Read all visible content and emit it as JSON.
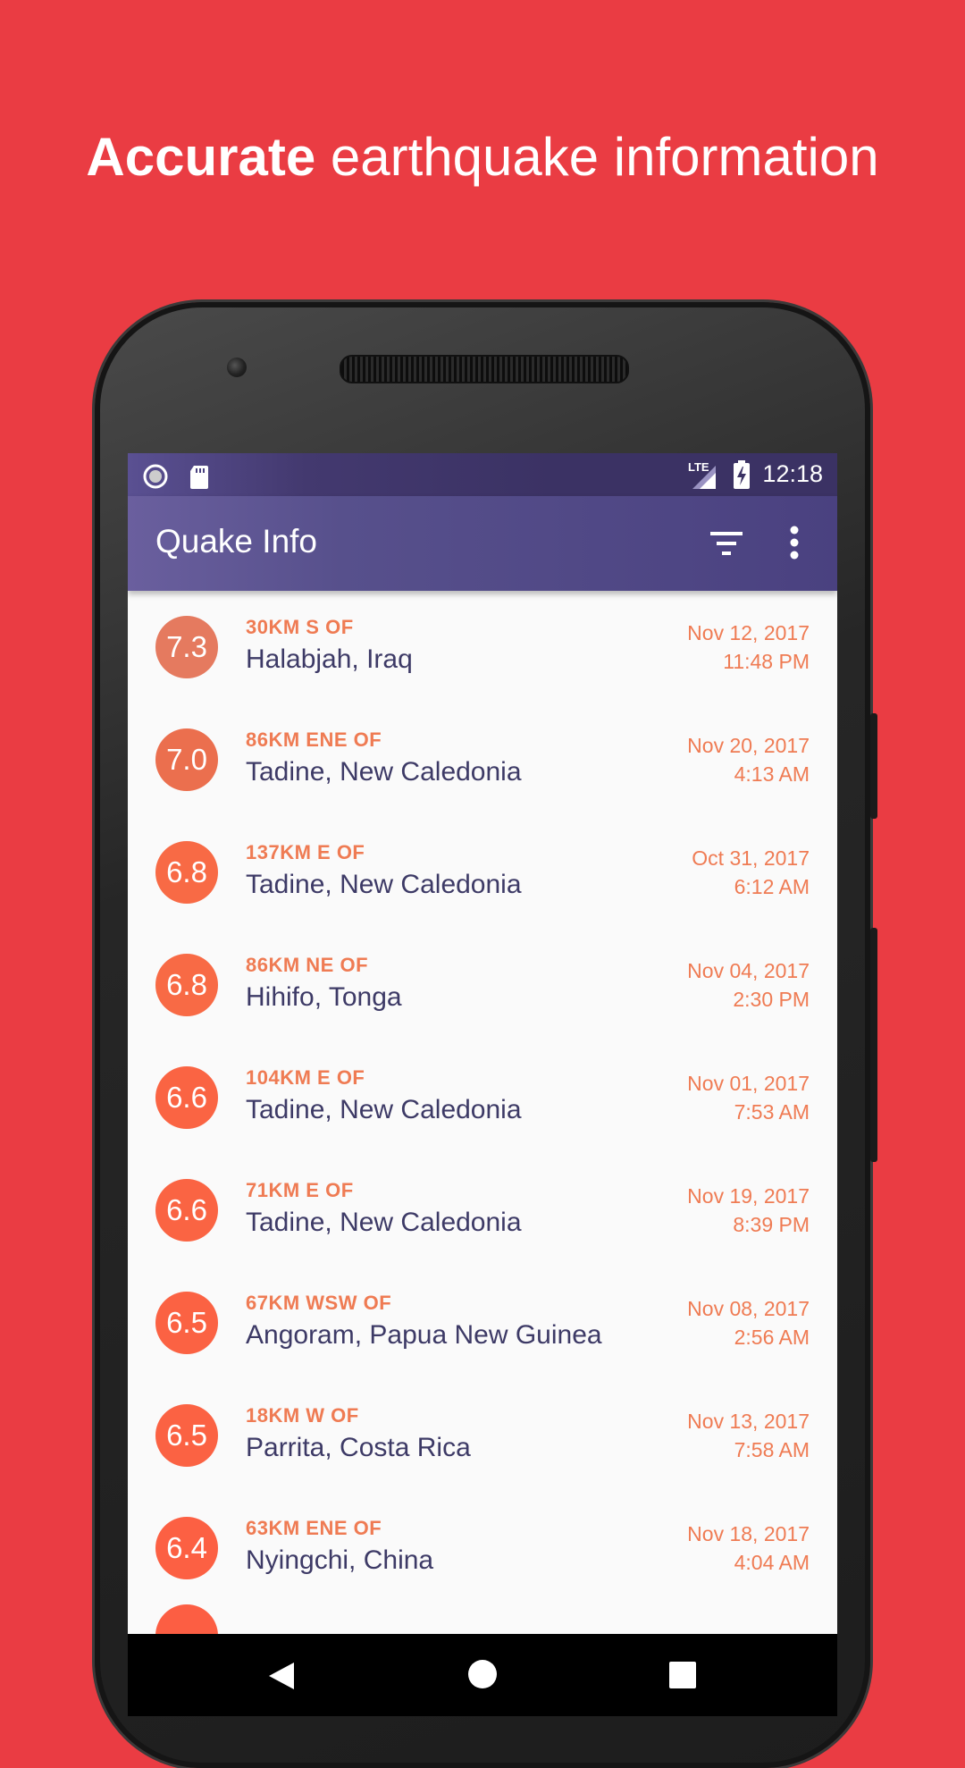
{
  "headline": {
    "bold": "Accurate",
    "rest": "earthquake information"
  },
  "status_bar": {
    "time": "12:18",
    "network": "LTE"
  },
  "app_bar": {
    "title": "Quake Info",
    "filter_icon": "filter-icon",
    "more_icon": "more-vert-icon"
  },
  "quakes": [
    {
      "mag": "7.3",
      "offset": "30KM S OF",
      "place": "Halabjah, Iraq",
      "date": "Nov 12, 2017",
      "time": "11:48 PM",
      "color": "#E57A5F"
    },
    {
      "mag": "7.0",
      "offset": "86KM ENE OF",
      "place": "Tadine, New Caledonia",
      "date": "Nov 20, 2017",
      "time": "4:13 AM",
      "color": "#EB6F4E"
    },
    {
      "mag": "6.8",
      "offset": "137KM E OF",
      "place": "Tadine, New Caledonia",
      "date": "Oct 31, 2017",
      "time": "6:12 AM",
      "color": "#F86A45"
    },
    {
      "mag": "6.8",
      "offset": "86KM NE OF",
      "place": "Hihifo, Tonga",
      "date": "Nov 04, 2017",
      "time": "2:30 PM",
      "color": "#F86A45"
    },
    {
      "mag": "6.6",
      "offset": "104KM E OF",
      "place": "Tadine, New Caledonia",
      "date": "Nov 01, 2017",
      "time": "7:53 AM",
      "color": "#FA6443"
    },
    {
      "mag": "6.6",
      "offset": "71KM E OF",
      "place": "Tadine, New Caledonia",
      "date": "Nov 19, 2017",
      "time": "8:39 PM",
      "color": "#FA6443"
    },
    {
      "mag": "6.5",
      "offset": "67KM WSW OF",
      "place": "Angoram, Papua New Guinea",
      "date": "Nov 08, 2017",
      "time": "2:56 AM",
      "color": "#FB6243"
    },
    {
      "mag": "6.5",
      "offset": "18KM W OF",
      "place": "Parrita, Costa Rica",
      "date": "Nov 13, 2017",
      "time": "7:58 AM",
      "color": "#FB6243"
    },
    {
      "mag": "6.4",
      "offset": "63KM ENE OF",
      "place": "Nyingchi, China",
      "date": "Nov 18, 2017",
      "time": "4:04 AM",
      "color": "#FC6043"
    }
  ],
  "colors": {
    "background": "#EA3C43",
    "accent": "#EF7B53",
    "primary": "#4A4180",
    "text": "#3D3A66"
  }
}
